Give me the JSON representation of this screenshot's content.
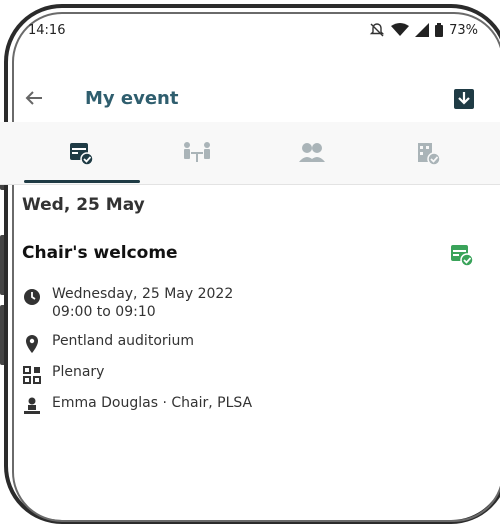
{
  "status_bar": {
    "time": "14:16",
    "battery": "73%"
  },
  "app_bar": {
    "title": "My event"
  },
  "tabs": [
    {
      "icon": "calendar-check-icon",
      "active": true
    },
    {
      "icon": "meeting-icon",
      "active": false
    },
    {
      "icon": "people-icon",
      "active": false
    },
    {
      "icon": "building-check-icon",
      "active": false
    }
  ],
  "date_header": "Wed, 25 May",
  "session": {
    "title": "Chair's welcome",
    "date": "Wednesday, 25 May 2022",
    "time": "09:00 to 09:10",
    "location": "Pentland auditorium",
    "category": "Plenary",
    "speaker": "Emma Douglas · Chair, PLSA"
  },
  "colors": {
    "accent": "#3aa35a",
    "title": "#2f5e6e",
    "tab_indicator": "#1f3b45"
  }
}
